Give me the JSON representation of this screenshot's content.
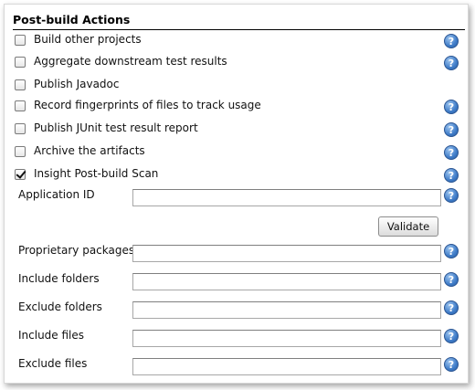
{
  "section": {
    "title": "Post-build Actions"
  },
  "actions": [
    {
      "label": "Build other projects",
      "checked": false,
      "help": true
    },
    {
      "label": "Aggregate downstream test results",
      "checked": false,
      "help": true
    },
    {
      "label": "Publish Javadoc",
      "checked": false,
      "help": false
    },
    {
      "label": "Record fingerprints of files to track usage",
      "checked": false,
      "help": true
    },
    {
      "label": "Publish JUnit test result report",
      "checked": false,
      "help": true
    },
    {
      "label": "Archive the artifacts",
      "checked": false,
      "help": true
    },
    {
      "label": "Insight Post-build Scan",
      "checked": true,
      "help": true
    }
  ],
  "insight": {
    "application_id": {
      "label": "Application ID",
      "value": ""
    },
    "validate_label": "Validate",
    "proprietary_packages": {
      "label": "Proprietary packages",
      "value": ""
    },
    "include_folders": {
      "label": "Include folders",
      "value": ""
    },
    "exclude_folders": {
      "label": "Exclude folders",
      "value": ""
    },
    "include_files": {
      "label": "Include files",
      "value": ""
    },
    "exclude_files": {
      "label": "Exclude files",
      "value": ""
    }
  },
  "help_glyph": "?",
  "icons": {
    "help": "help-question-icon",
    "checkbox": "checkbox"
  }
}
